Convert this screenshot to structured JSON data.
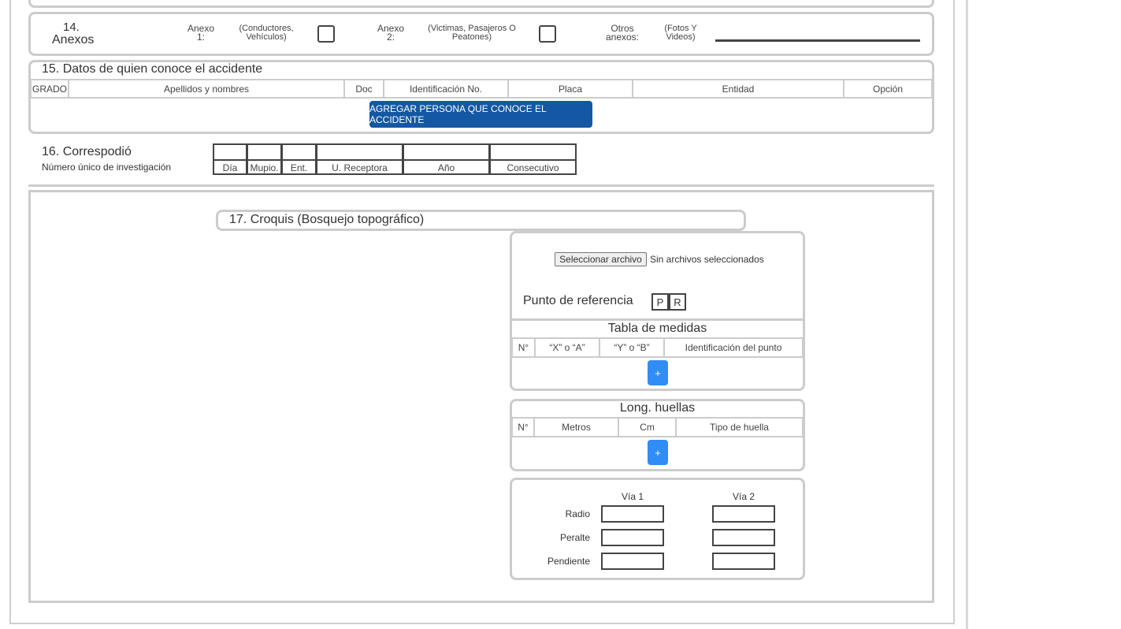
{
  "section14": {
    "number": "14.",
    "title": "Anexos",
    "anexo1_label": "Anexo 1:",
    "anexo1_desc": "(Conductores, Vehículos)",
    "anexo2_label": "Anexo 2:",
    "anexo2_desc": "(Victimas, Pasajeros O Peatones)",
    "otros_label": "Otros anexos:",
    "otros_desc": "(Fotos Y Videos)",
    "otros_value": ""
  },
  "section15": {
    "title": "15. Datos de quien conoce el accidente",
    "columns": [
      "GRADO",
      "Apellidos y nombres",
      "Doc",
      "Identificación No.",
      "Placa",
      "Entidad",
      "Opción"
    ],
    "add_button": "AGREGAR PERSONA QUE CONOCE EL ACCIDENTE"
  },
  "section16": {
    "title": "16. Correspodió",
    "subtitle": "Número único de investigación",
    "code_labels": [
      "Día",
      "Mupio.",
      "Ent.",
      "U. Receptora",
      "Año",
      "Consecutivo"
    ]
  },
  "section17": {
    "title": "17. Croquis (Bosquejo topográfico)",
    "file_button": "Seleccionar archivo",
    "file_status": "Sin archivos seleccionados",
    "reference_label": "Punto de referencia",
    "reference_boxes": [
      "P",
      "R"
    ],
    "medidas": {
      "title": "Tabla de medidas",
      "columns": [
        "N°",
        "“X” o “A”",
        "“Y” o “B”",
        "Identificación del punto"
      ],
      "add_label": "+"
    },
    "huellas": {
      "title": "Long. huellas",
      "columns": [
        "N°",
        "Metros",
        "Cm",
        "Tipo de huella"
      ],
      "add_label": "+"
    },
    "vias": {
      "headers": [
        "Vía 1",
        "Vía 2"
      ],
      "rows": [
        "Radio",
        "Peralte",
        "Pendiente"
      ]
    }
  },
  "colors": {
    "primary_button": "#1458a3",
    "add_button": "#2f8df5",
    "border": "#cccccc"
  }
}
